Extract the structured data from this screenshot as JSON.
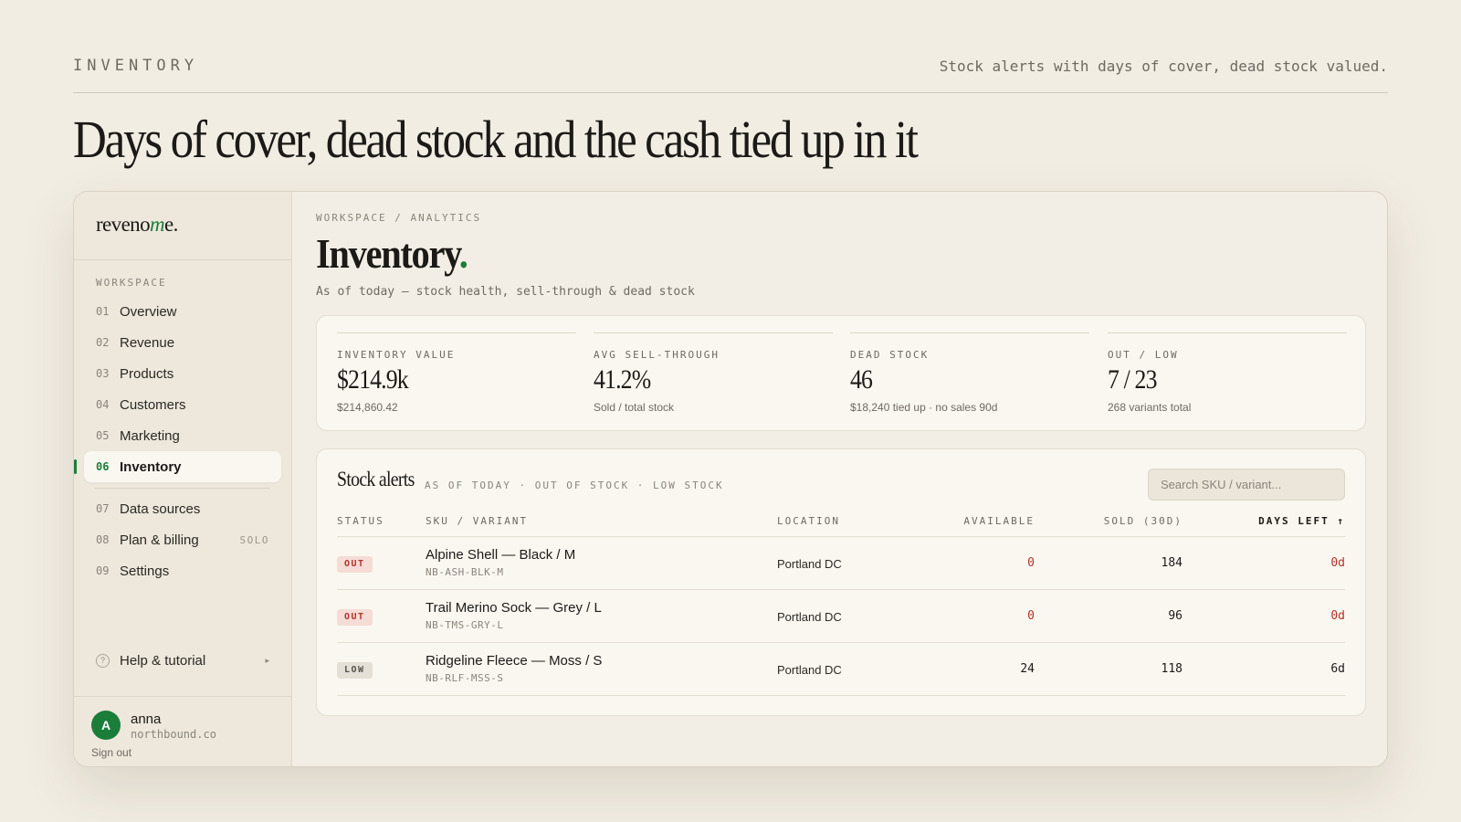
{
  "page": {
    "eyebrow": "INVENTORY",
    "tagline": "Stock alerts with days of cover, dead stock valued.",
    "headline": "Days of cover, dead stock and the cash tied up in it"
  },
  "sidebar": {
    "logo_pre": "reveno",
    "logo_accent": "m",
    "logo_post": "e.",
    "section_label": "WORKSPACE",
    "items": [
      {
        "num": "01",
        "label": "Overview"
      },
      {
        "num": "02",
        "label": "Revenue"
      },
      {
        "num": "03",
        "label": "Products"
      },
      {
        "num": "04",
        "label": "Customers"
      },
      {
        "num": "05",
        "label": "Marketing"
      },
      {
        "num": "06",
        "label": "Inventory"
      },
      {
        "num": "07",
        "label": "Data sources"
      },
      {
        "num": "08",
        "label": "Plan & billing",
        "tag": "SOLO"
      },
      {
        "num": "09",
        "label": "Settings"
      }
    ],
    "help_label": "Help & tutorial",
    "help_icon": "?",
    "help_arrow": "▸",
    "user": {
      "initial": "A",
      "name": "anna",
      "org": "northbound.co",
      "sign_out": "Sign out"
    }
  },
  "main": {
    "breadcrumb": "WORKSPACE / ANALYTICS",
    "title": "Inventory",
    "title_dot": ".",
    "subtitle": "As of today — stock health, sell-through & dead stock",
    "kpis": [
      {
        "label": "INVENTORY VALUE",
        "value": "$214.9k",
        "sub": "$214,860.42"
      },
      {
        "label": "AVG SELL-THROUGH",
        "value": "41.2%",
        "sub": "Sold / total stock"
      },
      {
        "label": "DEAD STOCK",
        "value": "46",
        "sub": "$18,240 tied up · no sales 90d"
      },
      {
        "label": "OUT / LOW",
        "value": "7 / 23",
        "sub": "268 variants total"
      }
    ],
    "alerts": {
      "title": "Stock alerts",
      "meta": "AS OF TODAY · OUT OF STOCK · LOW STOCK",
      "search_placeholder": "Search SKU / variant...",
      "columns": {
        "status": "STATUS",
        "sku": "SKU / VARIANT",
        "location": "LOCATION",
        "available": "AVAILABLE",
        "sold": "SOLD (30D)",
        "days_left": "DAYS LEFT ↑"
      },
      "rows": [
        {
          "status": "OUT",
          "name": "Alpine Shell — Black / M",
          "code": "NB-ASH-BLK-M",
          "location": "Portland DC",
          "available": "0",
          "sold": "184",
          "days_left": "0d"
        },
        {
          "status": "OUT",
          "name": "Trail Merino Sock — Grey / L",
          "code": "NB-TMS-GRY-L",
          "location": "Portland DC",
          "available": "0",
          "sold": "96",
          "days_left": "0d"
        },
        {
          "status": "LOW",
          "name": "Ridgeline Fleece — Moss / S",
          "code": "NB-RLF-MSS-S",
          "location": "Portland DC",
          "available": "24",
          "sold": "118",
          "days_left": "6d"
        }
      ]
    }
  },
  "colors": {
    "background": "#f2ede3",
    "accent": "#1a7d3a",
    "alert_red": "#b3322a",
    "card": "#faf7f0"
  },
  "icons": {
    "help": "help-circle-icon",
    "help_arrow": "chevron-right-icon",
    "sort": "arrow-up-icon"
  }
}
